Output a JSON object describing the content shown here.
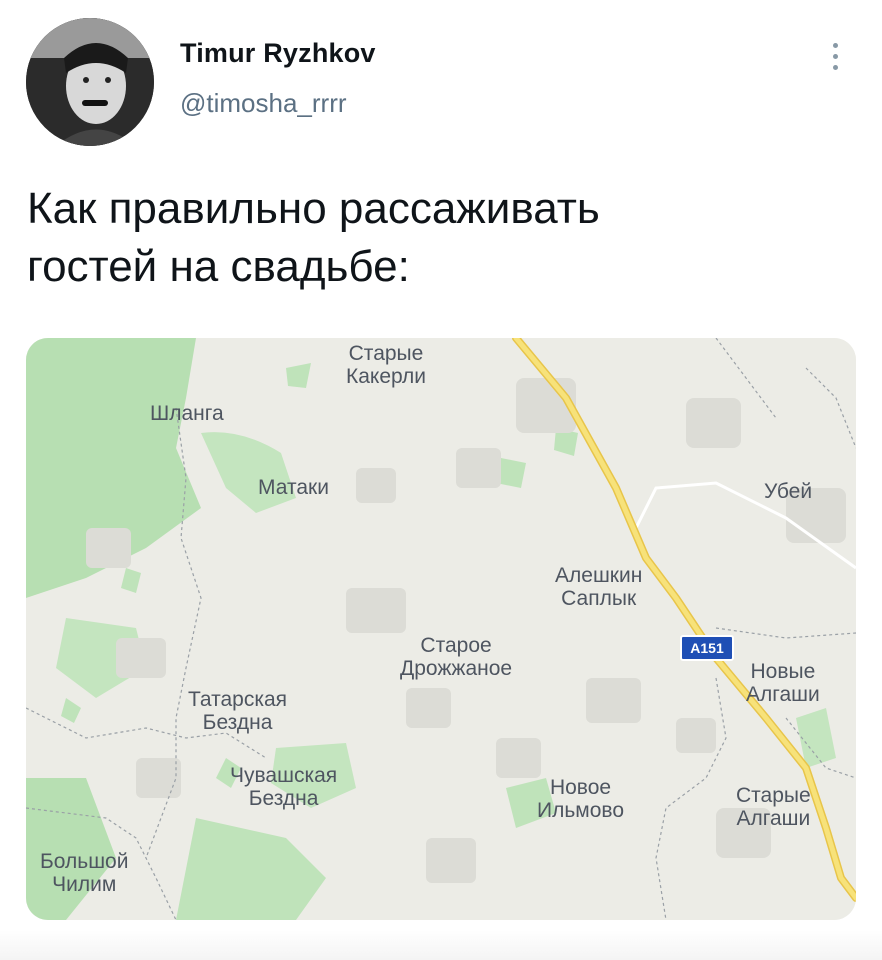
{
  "author": {
    "name": "Timur Ryzhkov",
    "handle": "@timosha_rrrr"
  },
  "tweet": {
    "text": "Как правильно рассаживать\nгостей на свадьбе:"
  },
  "map": {
    "labels": [
      "Старые\nКакерли",
      "Шланга",
      "Матаки",
      "Убей",
      "Алешкин\nСаплык",
      "Старое\nДрожжаное",
      "Новые\nАлгаши",
      "Татарская\nБездна",
      "Чувашская\nБездна",
      "Новое\nИльмово",
      "Старые\nАлгаши",
      "Большой\nЧилим"
    ],
    "road_sign": "A151",
    "colors": {
      "land": "#ecece6",
      "forest": "#b7dfb2",
      "road": "#f5dc6e",
      "sign": "#1f4fb5"
    }
  },
  "icons": {
    "more": "more-vertical-icon"
  }
}
